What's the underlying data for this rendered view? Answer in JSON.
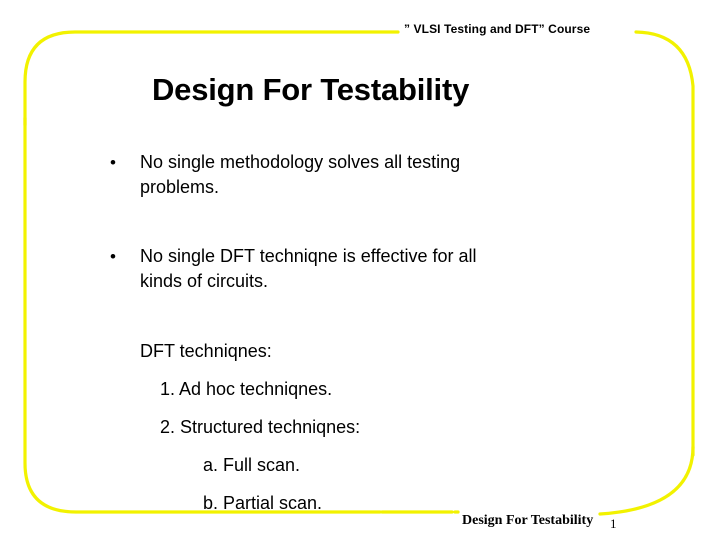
{
  "slide": {
    "header": "” VLSI Testing and DFT” Course",
    "title": "Design For Testability",
    "accent_color": "#F2F200",
    "background_color": "#FFFFFF",
    "text_color": "#000000"
  },
  "body": {
    "bullets": [
      {
        "marker": "•",
        "line1": "No single methodology solves all testing",
        "line2": "problems."
      },
      {
        "marker": "•",
        "line1": "No single DFT techniqne is effective for all",
        "line2": "kinds of circuits."
      }
    ],
    "heading": "DFT techniqnes:",
    "numbered_items": [
      "1. Ad hoc techniqnes.",
      "2. Structured techniqnes:"
    ],
    "lettered_items": [
      "a. Full scan.",
      "b. Partial scan."
    ]
  },
  "footer": {
    "title": "Design For Testability",
    "page_number": "1"
  }
}
